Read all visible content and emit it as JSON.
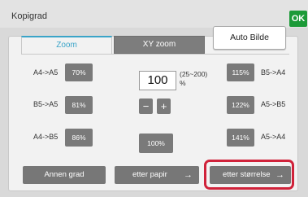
{
  "header": {
    "title": "Kopigrad",
    "ok_label": "OK"
  },
  "tabs": [
    {
      "label": "Zoom",
      "active": true
    },
    {
      "label": "XY zoom",
      "active": false
    }
  ],
  "auto_button": {
    "label": "Auto Bilde"
  },
  "left_presets": [
    {
      "label": "A4->A5",
      "value": "70%"
    },
    {
      "label": "B5->A5",
      "value": "81%"
    },
    {
      "label": "A4->B5",
      "value": "86%"
    }
  ],
  "right_presets": [
    {
      "label": "B5->A4",
      "value": "115%"
    },
    {
      "label": "A5->B5",
      "value": "122%"
    },
    {
      "label": "A5->A4",
      "value": "141%"
    }
  ],
  "zoom": {
    "value": "100",
    "range": "(25~200)",
    "unit": "%",
    "minus": "−",
    "plus": "+",
    "reset_label": "100%"
  },
  "bottom_buttons": {
    "annen": "Annen grad",
    "papir": "etter papir",
    "storrelse": "etter størrelse",
    "arrow": "→"
  },
  "colors": {
    "ok": "#1c9a38",
    "active_tab": "#3aa4c8",
    "highlight": "#d0223a",
    "button": "#7a7a7a"
  }
}
